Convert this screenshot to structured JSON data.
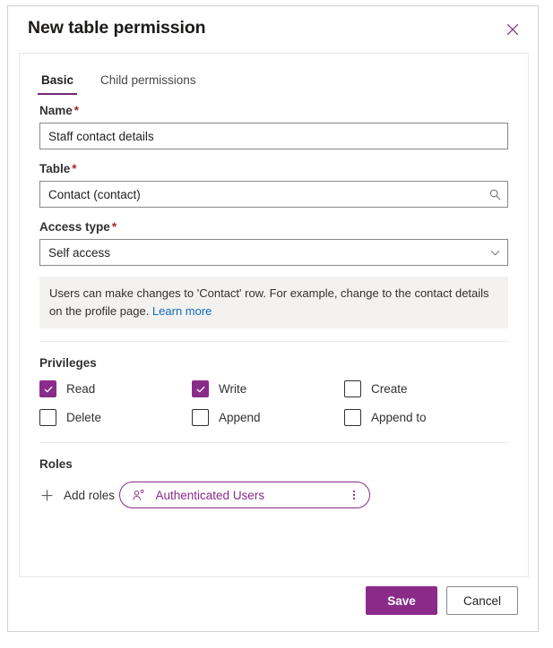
{
  "dialog": {
    "title": "New table permission",
    "close_icon": "close-icon"
  },
  "tabs": [
    {
      "label": "Basic",
      "active": true
    },
    {
      "label": "Child permissions",
      "active": false
    }
  ],
  "fields": {
    "name": {
      "label": "Name",
      "required_marker": "*",
      "value": "Staff contact details",
      "placeholder": ""
    },
    "table": {
      "label": "Table",
      "required_marker": "*",
      "value": "Contact (contact)",
      "placeholder": "",
      "icon": "search-icon"
    },
    "access_type": {
      "label": "Access type",
      "required_marker": "*",
      "value": "Self access",
      "icon": "chevron-down-icon",
      "options": [
        "Self access"
      ]
    }
  },
  "info": {
    "text": "Users can make changes to 'Contact' row. For example, change to the contact details on the profile page. ",
    "link_label": "Learn more"
  },
  "privileges": {
    "title": "Privileges",
    "items": [
      {
        "label": "Read",
        "checked": true
      },
      {
        "label": "Write",
        "checked": true
      },
      {
        "label": "Create",
        "checked": false
      },
      {
        "label": "Delete",
        "checked": false
      },
      {
        "label": "Append",
        "checked": false
      },
      {
        "label": "Append to",
        "checked": false
      }
    ]
  },
  "roles": {
    "title": "Roles",
    "add_label": "Add roles",
    "add_icon": "plus-icon",
    "items": [
      {
        "name": "Authenticated Users",
        "icon": "user-role-icon",
        "more_icon": "more-vertical-icon"
      }
    ]
  },
  "footer": {
    "save_label": "Save",
    "cancel_label": "Cancel"
  },
  "colors": {
    "accent": "#8a2b8a",
    "tab_underline": "#742774",
    "required": "#a4262c",
    "link": "#0f6cbd",
    "info_bg": "#f3f2f1"
  }
}
